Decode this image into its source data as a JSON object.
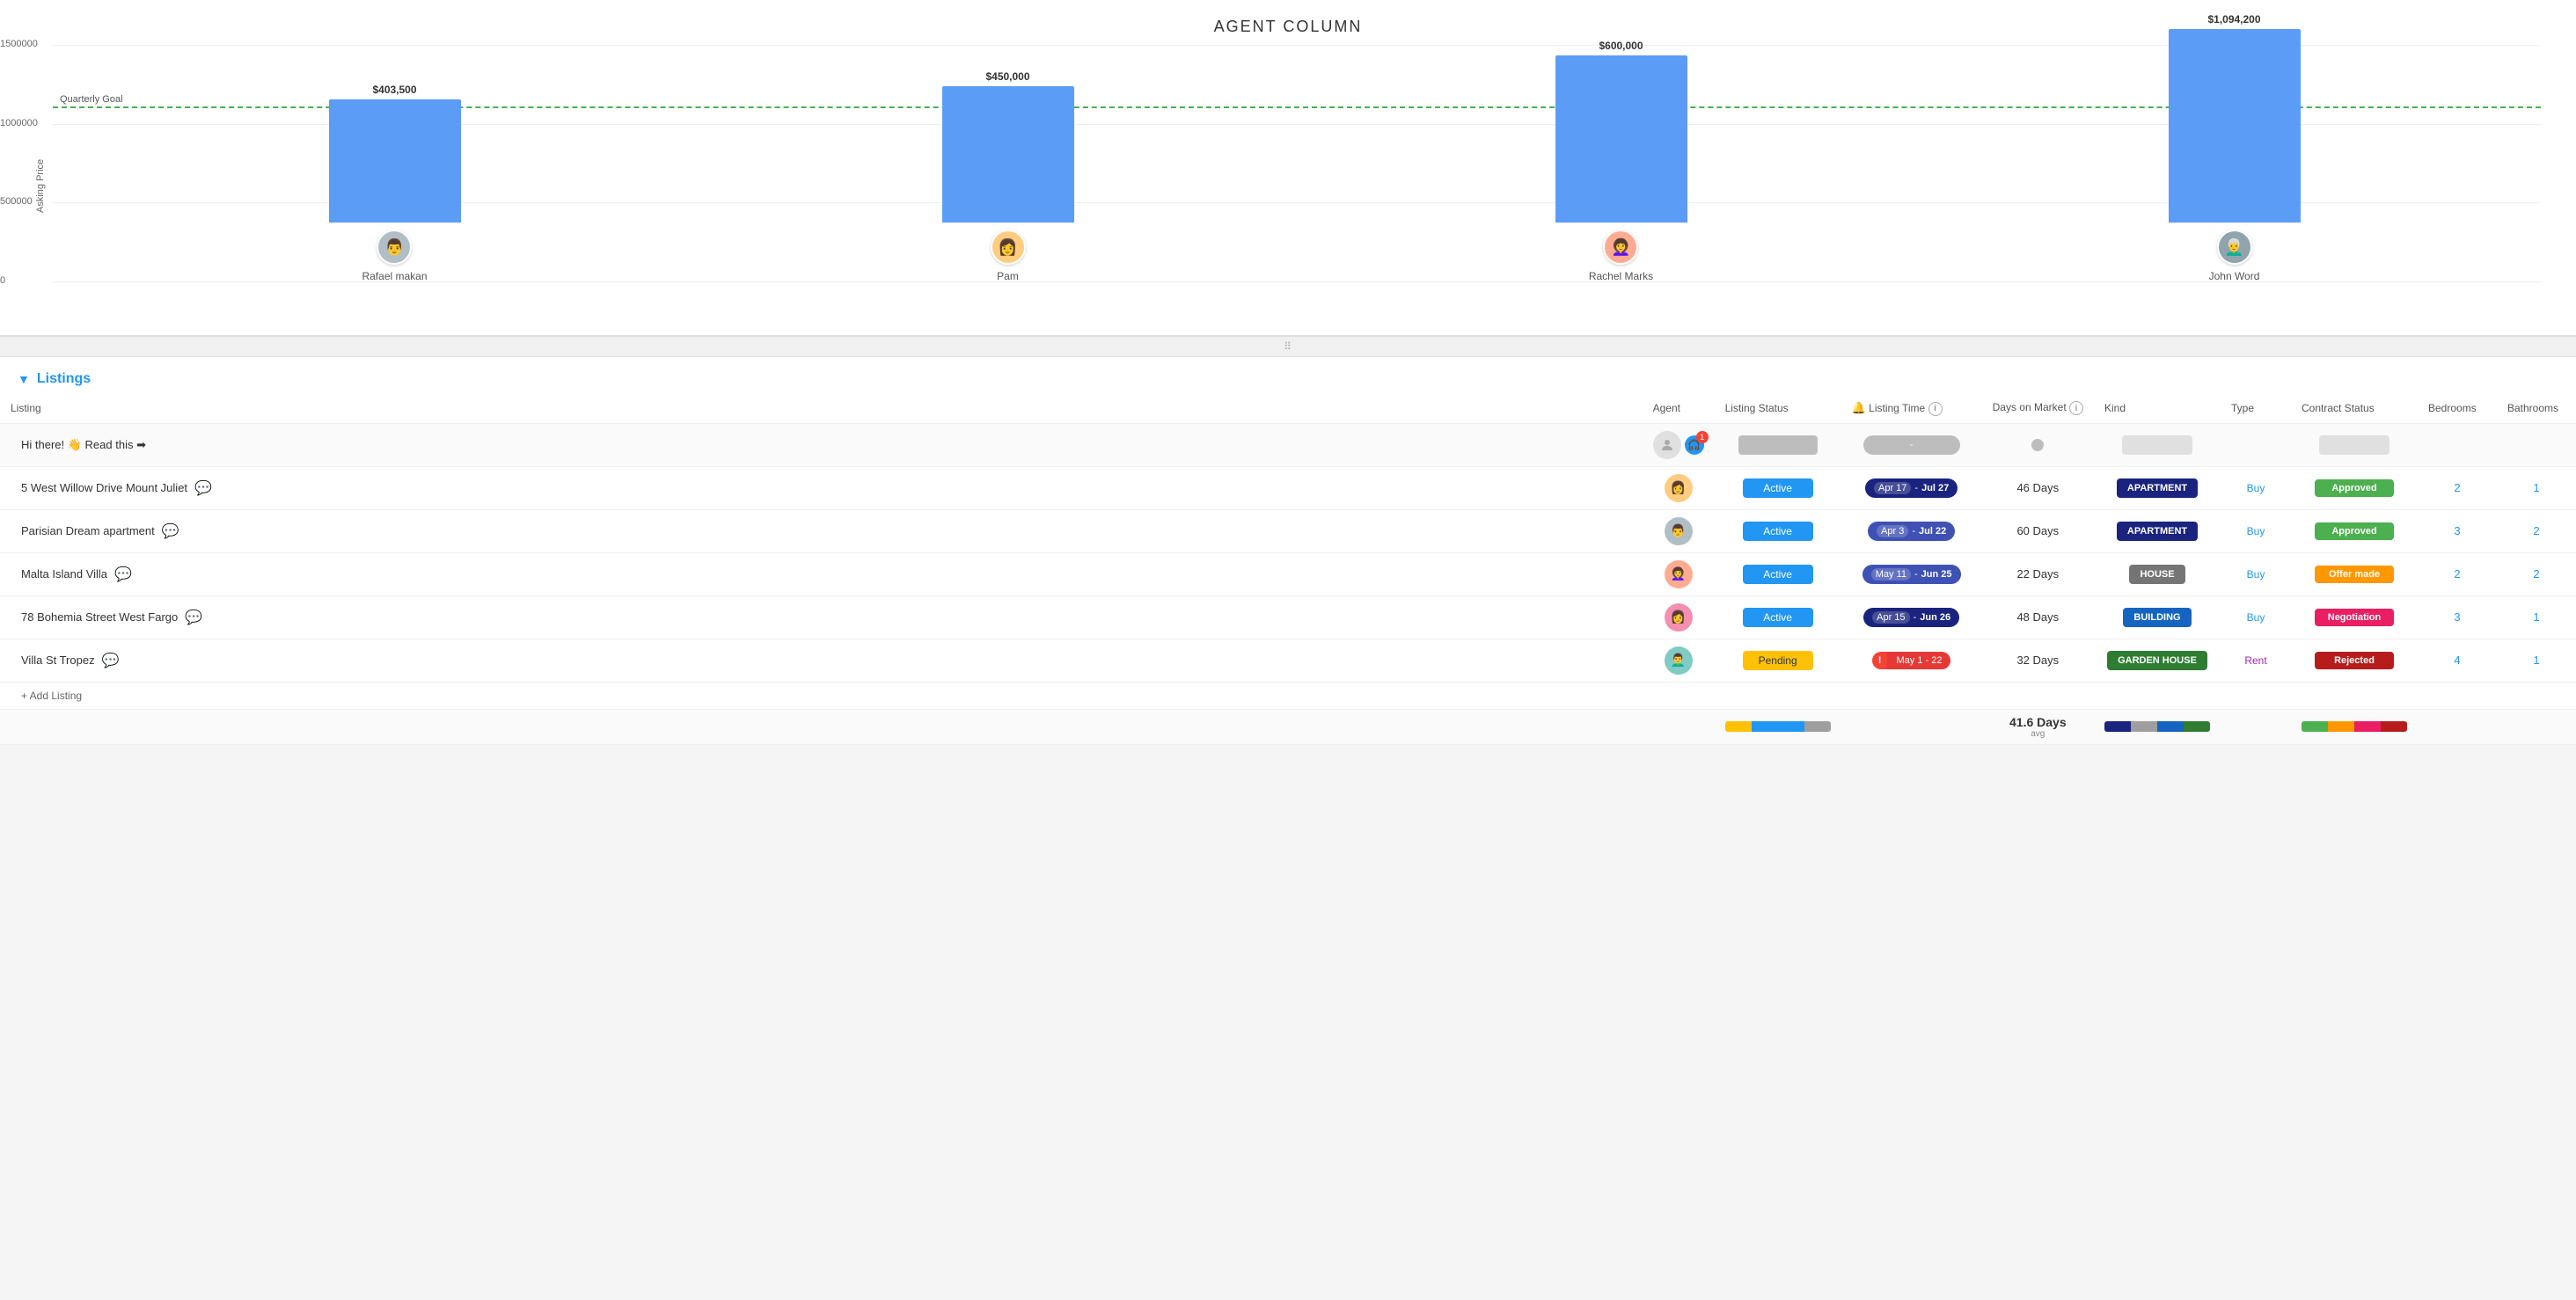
{
  "page": {
    "title": "AGENT COLUMN"
  },
  "chart": {
    "y_axis_label": "Asking Price",
    "y_axis_values": [
      "1500000",
      "1000000",
      "500000",
      "0"
    ],
    "quarterly_goal_label": "Quarterly Goal",
    "agents": [
      {
        "name": "Rafael makan",
        "value": "$403,500",
        "bar_height_pct": 27,
        "avatar_emoji": "👨"
      },
      {
        "name": "Pam",
        "value": "$450,000",
        "bar_height_pct": 30,
        "avatar_emoji": "👩"
      },
      {
        "name": "Rachel Marks",
        "value": "$600,000",
        "bar_height_pct": 40,
        "avatar_emoji": "👩‍🦱"
      },
      {
        "name": "John Word",
        "value": "$1,094,200",
        "bar_height_pct": 73,
        "avatar_emoji": "👨‍🦳"
      }
    ]
  },
  "table": {
    "section_title": "Listings",
    "columns": {
      "listing": "Listing",
      "agent": "Agent",
      "listing_status": "Listing Status",
      "listing_time": "Listing Time",
      "days_on_market": "Days on Market",
      "kind": "Kind",
      "type": "Type",
      "contract_status": "Contract Status",
      "bedrooms": "Bedrooms",
      "bathrooms": "Bathrooms"
    },
    "hi_row": {
      "text": "Hi there! 👋 Read this",
      "arrow": "➡"
    },
    "rows": [
      {
        "listing": "5 West Willow Drive Mount Juliet",
        "listing_status": "Active",
        "listing_status_class": "badge-active",
        "time_start": "Apr 17",
        "time_end": "Jul 27",
        "time_class": "time-badge-blue2",
        "days": "46 Days",
        "kind": "Apartment",
        "kind_class": "kind-apartment",
        "type": "Buy",
        "type_class": "type-link",
        "contract": "Approved",
        "contract_class": "contract-approved",
        "beds": "2",
        "baths": "1",
        "avatar_emoji": "👩"
      },
      {
        "listing": "Parisian Dream apartment",
        "listing_status": "Active",
        "listing_status_class": "badge-active",
        "time_start": "Apr 3",
        "time_end": "Jul 22",
        "time_class": "time-badge-blue",
        "days": "60 Days",
        "kind": "Apartment",
        "kind_class": "kind-apartment",
        "type": "Buy",
        "type_class": "type-link",
        "contract": "Approved",
        "contract_class": "contract-approved",
        "beds": "3",
        "baths": "2",
        "avatar_emoji": "👨"
      },
      {
        "listing": "Malta Island Villa",
        "listing_status": "Active",
        "listing_status_class": "badge-active",
        "time_start": "May 11",
        "time_end": "Jun 25",
        "time_class": "time-badge-blue",
        "days": "22 Days",
        "kind": "House",
        "kind_class": "kind-house",
        "type": "Buy",
        "type_class": "type-link",
        "contract": "Offer made",
        "contract_class": "contract-offer",
        "beds": "2",
        "baths": "2",
        "avatar_emoji": "👩‍🦱"
      },
      {
        "listing": "78 Bohemia Street West Fargo",
        "listing_status": "Active",
        "listing_status_class": "badge-active",
        "time_start": "Apr 15",
        "time_end": "Jun 26",
        "time_class": "time-badge-blue2",
        "days": "48 Days",
        "kind": "Building",
        "kind_class": "kind-building",
        "type": "Buy",
        "type_class": "type-link",
        "contract": "Negotiation",
        "contract_class": "contract-negotiation",
        "beds": "3",
        "baths": "1",
        "avatar_emoji": "👩"
      },
      {
        "listing": "Villa St Tropez",
        "listing_status": "Pending",
        "listing_status_class": "badge-pending",
        "time_start": "May 1",
        "time_end": "22",
        "time_class": "time-badge-warning",
        "has_exclaim": true,
        "days": "32 Days",
        "kind": "Garden house",
        "kind_class": "kind-garden",
        "type": "Rent",
        "type_class": "type-link type-rent",
        "contract": "Rejected",
        "contract_class": "contract-rejected",
        "beds": "4",
        "baths": "1",
        "avatar_emoji": "👨‍🦱"
      }
    ],
    "add_listing": "+ Add Listing",
    "summary": {
      "avg_days": "41.6 Days",
      "avg_label": "avg"
    }
  }
}
